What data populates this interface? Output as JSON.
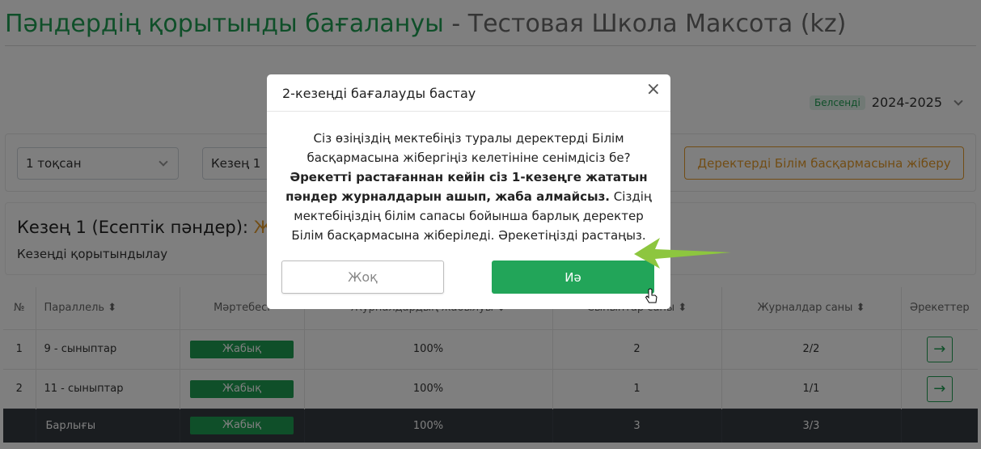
{
  "page": {
    "title_main": "Пәндердің қорытынды бағалануы",
    "title_sep": " - ",
    "title_school": "Тестовая Школа Максота (kz)"
  },
  "status": {
    "badge": "Белсенді",
    "year": "2024-2025"
  },
  "filters": {
    "quarter": "1 тоқсан",
    "period": "Кезең 1",
    "send_button": "Деректерді Білім басқармасына жіберу"
  },
  "period_card": {
    "title": "Кезең 1 (Есептік пәндер): ",
    "title_status": "Жа",
    "subtitle": "Кезеңді қорытындылау"
  },
  "table": {
    "headers": [
      "№",
      "Параллель",
      "Мәртебесі",
      "Журналдардың жабылуы",
      "Сыныптар саны",
      "Журналдар саны",
      "Әрекеттер"
    ],
    "rows": [
      {
        "num": "1",
        "parallel": "9 - сыныптар",
        "status": "Жабық",
        "closure": "100%",
        "classes": "2",
        "journals": "2/2"
      },
      {
        "num": "2",
        "parallel": "11 - сыныптар",
        "status": "Жабық",
        "closure": "100%",
        "classes": "1",
        "journals": "1/1"
      }
    ],
    "total": {
      "label": "Барлығы",
      "status": "Жабық",
      "closure": "100%",
      "classes": "3",
      "journals": "3/3"
    }
  },
  "modal": {
    "title": "2-кезеңді бағалауды бастау",
    "close": "×",
    "text_1": "Сіз өзіңіздің мектебіңіз туралы деректерді Білім басқармасына жібергіңіз келетініне сенімдісіз бе?",
    "text_bold": "Әрекетті растағаннан кейін сіз 1-кезеңге жататын пәндер журналдарын ашып, жаба алмайсыз.",
    "text_2": "Сіздің мектебіңіздің білім сапасы бойынша барлық деректер Білім басқармасына жіберіледі. Әрекетіңізді растаңыз.",
    "no": "Жоқ",
    "yes": "Иә"
  },
  "colors": {
    "brand_green": "#1e9e52",
    "accent_orange": "#e59b2a",
    "annotation_arrow": "#8dc63f"
  }
}
